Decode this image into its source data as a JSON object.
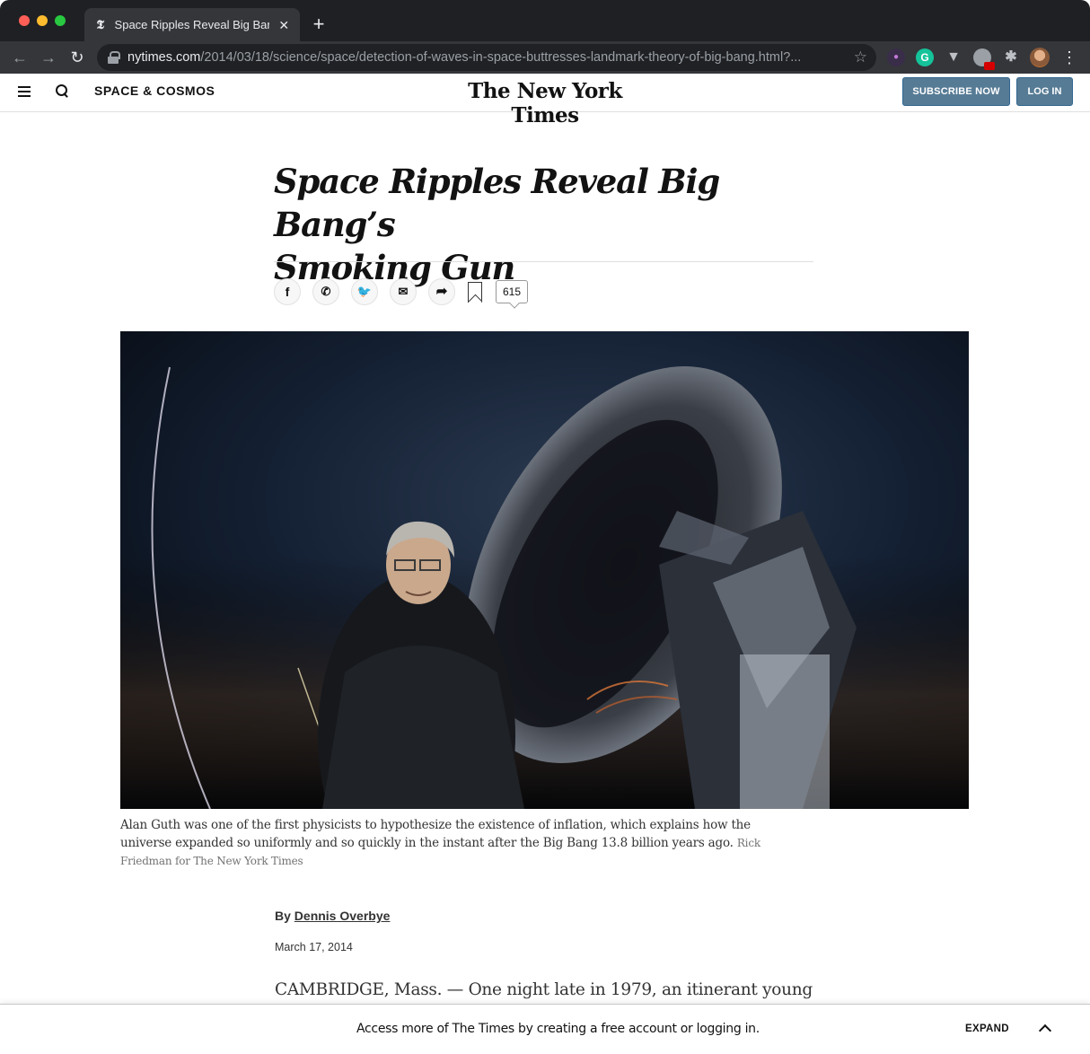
{
  "browser": {
    "tab_title": "Space Ripples Reveal Big Bang",
    "tab_favicon": "𝕿",
    "new_tab_label": "+",
    "url_host": "nytimes.com",
    "url_path": "/2014/03/18/science/space/detection-of-waves-in-space-buttresses-landmark-theory-of-big-bang.html?...",
    "icons": [
      "back-arrow-icon",
      "forward-arrow-icon",
      "reload-icon",
      "lock-icon",
      "star-icon",
      "extension-icon",
      "avatar",
      "menu-dots-icon"
    ]
  },
  "header": {
    "section": "SPACE & COSMOS",
    "masthead": "The New York Times",
    "subscribe_label": "SUBSCRIBE NOW",
    "login_label": "LOG IN"
  },
  "article": {
    "headline_line1": "Space Ripples Reveal Big Bang’s",
    "headline_line2": "Smoking Gun",
    "comment_count": "615",
    "share_icons": [
      "facebook-icon",
      "whatsapp-icon",
      "twitter-icon",
      "email-icon",
      "share-icon",
      "bookmark-icon"
    ],
    "caption": "Alan Guth was one of the first physicists to hypothesize the existence of inflation, which explains how the universe expanded so uniformly and so quickly in the instant after the Big Bang 13.8 billion years ago.",
    "caption_credit": "Rick Friedman for The New York Times",
    "byline_prefix": "By",
    "author": "Dennis Overbye",
    "date": "March 17, 2014",
    "lead": "CAMBRIDGE, Mass. — One night late in 1979, an itinerant young"
  },
  "banner": {
    "text": "Access more of The Times by creating a free account or logging in.",
    "expand_label": "EXPAND"
  }
}
